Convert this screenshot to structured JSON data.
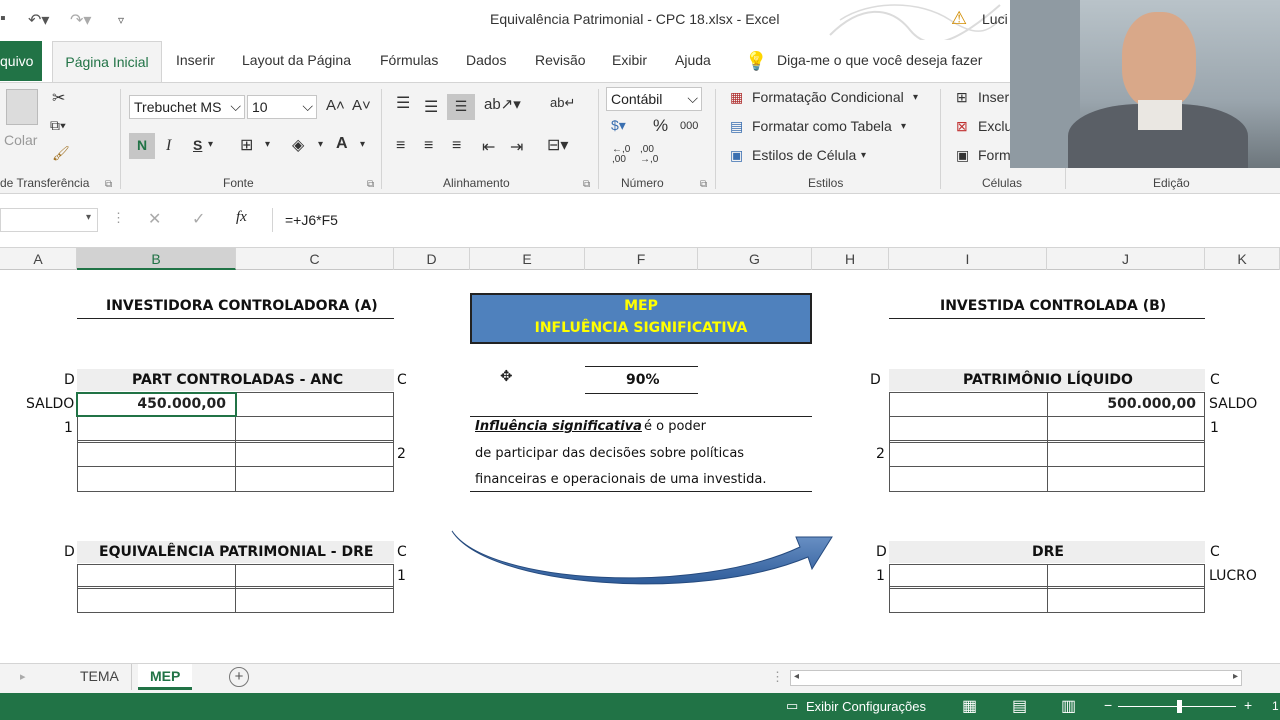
{
  "window": {
    "title": "Equivalência Patrimonial - CPC 18.xlsx  -  Excel",
    "user": "Luci"
  },
  "tabs": {
    "file": "quivo",
    "home": "Página Inicial",
    "insert": "Inserir",
    "layout": "Layout da Página",
    "formulas": "Fórmulas",
    "data": "Dados",
    "review": "Revisão",
    "view": "Exibir",
    "help": "Ajuda",
    "tell_me": "Diga-me o que você deseja fazer"
  },
  "ribbon": {
    "clipboard": {
      "paste": "Colar",
      "label": "de Transferência"
    },
    "font": {
      "name": "Trebuchet MS",
      "size": "10",
      "bold": "N",
      "italic": "I",
      "underline": "S",
      "label": "Fonte"
    },
    "alignment": {
      "label": "Alinhamento"
    },
    "number": {
      "format": "Contábil",
      "percent": "%",
      "thousands": "000",
      "inc_dec": "←,0\n,00",
      "dec_dec": ",00\n→,0",
      "label": "Número"
    },
    "styles": {
      "conditional": "Formatação Condicional",
      "as_table": "Formatar como Tabela",
      "cell_styles": "Estilos de Célula",
      "label": "Estilos"
    },
    "cells": {
      "insert": "Inser",
      "delete": "Exclu",
      "format": "Form",
      "label": "Células"
    },
    "editing": {
      "label": "Edição"
    }
  },
  "formula_bar": {
    "fx": "fx",
    "formula": "=+J6*F5"
  },
  "columns": [
    "A",
    "B",
    "C",
    "D",
    "E",
    "F",
    "G",
    "H",
    "I",
    "J",
    "K"
  ],
  "sheet": {
    "left_title": "INVESTIDORA CONTROLADORA (A)",
    "mep_line1": "MEP",
    "mep_line2": "INFLUÊNCIA SIGNIFICATIVA",
    "right_title": "INVESTIDA CONTROLADA (B)",
    "d_label": "D",
    "c_label": "C",
    "anc_header": "PART CONTROLADAS - ANC",
    "saldo": "SALDO",
    "row1": "1",
    "row2": "2",
    "anc_value": "450.000,00",
    "percent": "90%",
    "pl_header": "PATRIMÔNIO LÍQUIDO",
    "pl_value": "500.000,00",
    "def_term": "Influência significativa",
    "def_rest1": "é o poder",
    "def_line2": "de participar das decisões sobre políticas",
    "def_line3": "financeiras e operacionais de uma investida.",
    "eq_header": "EQUIVALÊNCIA PATRIMONIAL - DRE",
    "dre_header": "DRE",
    "lucro": "LUCRO"
  },
  "sheet_tabs": [
    "TEMA",
    "MEP"
  ],
  "status": {
    "display_settings": "Exibir Configurações",
    "zoom_end": "1"
  },
  "colors": {
    "excel_green": "#217346",
    "mep_fill": "#4f81bd",
    "mep_text": "#ffff00",
    "arrow": "#2e5c9a"
  }
}
